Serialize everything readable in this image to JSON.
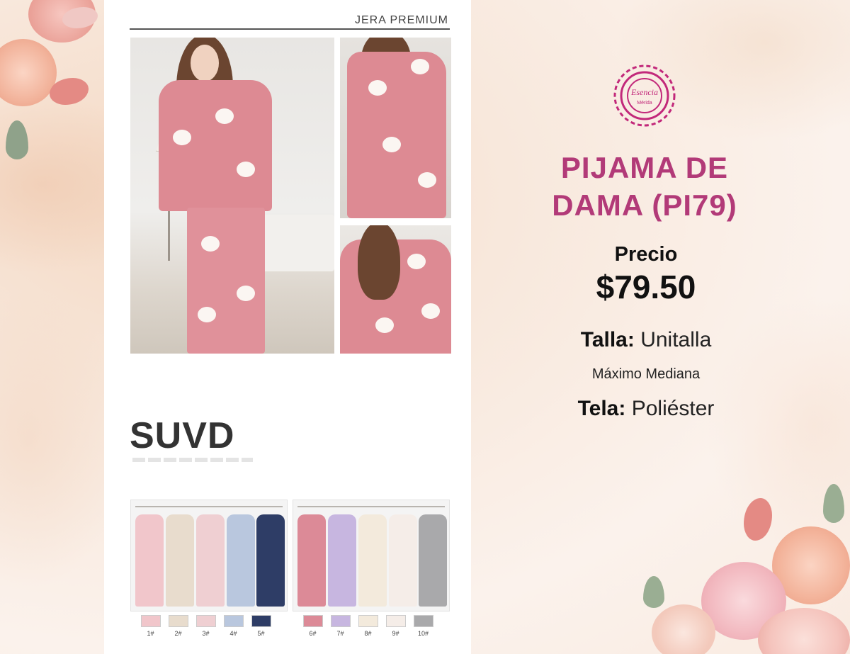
{
  "catalog": {
    "brand_header": "JERA PREMIUM",
    "logo": "SUVD",
    "variants_left": [
      {
        "label": "1#",
        "color": "#f1c6cb"
      },
      {
        "label": "2#",
        "color": "#e8dccd"
      },
      {
        "label": "3#",
        "color": "#efcfd2"
      },
      {
        "label": "4#",
        "color": "#b9c7de"
      },
      {
        "label": "5#",
        "color": "#2e3d66"
      }
    ],
    "variants_right": [
      {
        "label": "6#",
        "color": "#dc8a97"
      },
      {
        "label": "7#",
        "color": "#c7b6e0"
      },
      {
        "label": "8#",
        "color": "#f3eadc"
      },
      {
        "label": "9#",
        "color": "#f5ede8"
      },
      {
        "label": "10#",
        "color": "#a9a9ab"
      }
    ]
  },
  "emblem": {
    "name": "Esencia",
    "subtitle": "Mérida",
    "color": "#c2287a"
  },
  "product": {
    "title_line1": "PIJAMA DE",
    "title_line2": "DAMA (PI79)",
    "price_label": "Precio",
    "price": "$79.50",
    "size_label": "Talla:",
    "size_value": "Unitalla",
    "size_note": "Máximo Mediana",
    "fabric_label": "Tela:",
    "fabric_value": "Poliéster"
  },
  "colors": {
    "title": "#b23a78",
    "accent_pink": "#dd8a93"
  }
}
